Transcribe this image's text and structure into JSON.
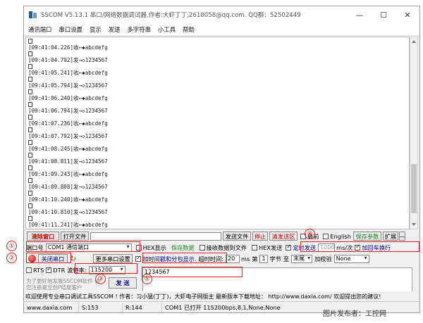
{
  "window": {
    "title": "SSCOM V5.13.1 串口/网络数据调试器,作者:大虾丁丁,2618058@qq.com. QQ群：52502449",
    "controls": {
      "minimize": "—",
      "maximize": "☐",
      "close": "✕"
    }
  },
  "menu": [
    "通讯端口",
    "串口设置",
    "显示",
    "发送",
    "多字符串",
    "小工具",
    "帮助"
  ],
  "log": {
    "lines": [
      {
        "ts": "[09:41:04.226]",
        "dir": "收←◆",
        "text": "abcdefg"
      },
      {
        "ts": "[09:41:04.792]",
        "dir": "发→◇",
        "text": "1234567"
      },
      {
        "ts": "[09:41:05.241]",
        "dir": "收←◆",
        "text": "abcdefg"
      },
      {
        "ts": "[09:41:05.794]",
        "dir": "发→◇",
        "text": "1234567"
      },
      {
        "ts": "[09:41:06.240]",
        "dir": "收←◆",
        "text": "abcdefg"
      },
      {
        "ts": "[09:41:06.794]",
        "dir": "发→◇",
        "text": "1234567"
      },
      {
        "ts": "[09:41:07.236]",
        "dir": "收←◆",
        "text": "abcdefg"
      },
      {
        "ts": "[09:41:07.792]",
        "dir": "发→◇",
        "text": "1234567"
      },
      {
        "ts": "[09:41:08.245]",
        "dir": "收←◆",
        "text": "abcdefg"
      },
      {
        "ts": "[09:41:08.811]",
        "dir": "发→◇",
        "text": "1234567"
      },
      {
        "ts": "[09:41:09.243]",
        "dir": "收←◆",
        "text": "abcdefg"
      },
      {
        "ts": "[09:41:09.808]",
        "dir": "发→◇",
        "text": "1234567"
      },
      {
        "ts": "[09:41:10.240]",
        "dir": "收←◆",
        "text": "abcdefg"
      },
      {
        "ts": "[09:41:10.810]",
        "dir": "发→◇",
        "text": "1234567"
      },
      {
        "ts": "[09:41:11.241]",
        "dir": "收←◆",
        "text": "abcdefg"
      }
    ]
  },
  "toolbar": {
    "clear_window": "清除窗口",
    "open_file": "打开文件",
    "send_file": "发送文件",
    "stop": "停止",
    "clear_send": "清发送区",
    "front": "最前",
    "english": "English",
    "save_params": "保存参数",
    "expand": "扩展",
    "minus": "—"
  },
  "port_row": {
    "port_label": "端口号",
    "port_value": "COM1 通信端口",
    "hex_display": "HEX显示",
    "save_data": "保存数据",
    "recv_to_file": "接收数据到文件",
    "hex_send": "HEX发送",
    "timed_send": "定时发送",
    "interval": "1000",
    "interval_unit": "ms/次",
    "add_newline": "加回车换行"
  },
  "open_row": {
    "close_port": "关闭串口",
    "more_settings": "更多串口设置",
    "timestamp_split": "加时间戳和分包显示.",
    "timeout_label": "超时时间:",
    "timeout_value": "20",
    "ms": "ms",
    "byte_label": "第",
    "byte_value": "1",
    "byte_unit": "字节",
    "to_label": "至",
    "end_value": "末尾",
    "checksum_label": "加校验",
    "checksum_value": "None"
  },
  "rts_row": {
    "rts": "RTS",
    "dtr": "DTR",
    "baud_label": "波特率:",
    "baud_value": "115200"
  },
  "send_area": {
    "text": "1234567"
  },
  "tip": {
    "text": "为了更好地发展SSCOM软件 请您注册嘉立创P结尾客户"
  },
  "send_button": "发 送",
  "promo": {
    "text": "欢迎使用专业串口调试工具SSCOM !  作者：习小猛(丁丁)，大虾电子网版主  最新版本下载地址： http://www.daxia.com/ 欢迎提出您的建议!"
  },
  "statusbar": {
    "website": "www.daxia.com",
    "sent": "S:153",
    "received": "R:144",
    "port_status": "COM1 已打开  115200bps,8,1,None,None"
  },
  "annotations": [
    "①",
    "②",
    "③",
    "④",
    "⑤"
  ],
  "watermark": "图片发布者：工控网",
  "colors": {
    "annotation": "#e02020",
    "green_text": "#1a8a1a",
    "red_text": "#c00000"
  }
}
